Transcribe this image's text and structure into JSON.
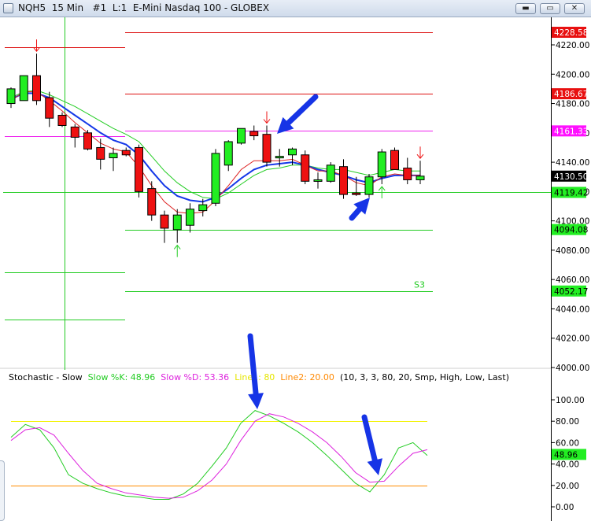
{
  "window": {
    "title": "NQH5  15 Min   #1  L:1  E-Mini Nasdaq 100 - GLOBEX",
    "buttons": [
      {
        "name": "minimize",
        "glyph": "▬"
      },
      {
        "name": "maximize",
        "glyph": "▭"
      },
      {
        "name": "close",
        "glyph": "✕"
      }
    ]
  },
  "chart_data": [
    {
      "type": "candlestick",
      "title": "",
      "symbol": "NQH5",
      "interval": "15 Min",
      "description": "E-Mini Nasdaq 100 - GLOBEX",
      "ylim": [
        4000,
        4240
      ],
      "y_ticks": [
        "4220.00",
        "4200.00",
        "4180.00",
        "4160.00",
        "4140.00",
        "4120.00",
        "4100.00",
        "4080.00",
        "4060.00",
        "4040.00",
        "4020.00",
        "4000.00"
      ],
      "price_markers": [
        {
          "label": "4228.58",
          "value": 4228.58,
          "color": "#e81010",
          "text_color": "#ffffff"
        },
        {
          "label": "4186.67",
          "value": 4186.67,
          "color": "#e81010",
          "text_color": "#ffffff"
        },
        {
          "label": "4161.33",
          "value": 4161.33,
          "color": "#ff10ff",
          "text_color": "#ffffff"
        },
        {
          "label": "4130.50",
          "value": 4130.5,
          "color": "#000000",
          "text_color": "#ffffff"
        },
        {
          "label": "4119.42",
          "value": 4119.42,
          "color": "#22ee22",
          "text_color": "#000000"
        },
        {
          "label": "4094.08",
          "value": 4094.08,
          "color": "#22ee22",
          "text_color": "#000000"
        },
        {
          "label": "4052.17",
          "value": 4052.17,
          "color": "#22ee22",
          "text_color": "#000000"
        }
      ],
      "level_lines": [
        {
          "value": 4228.58,
          "color": "#dd1111",
          "segment": "right"
        },
        {
          "value": 4218.5,
          "color": "#dd1111",
          "segment": "left"
        },
        {
          "value": 4186.67,
          "color": "#dd1111",
          "segment": "right"
        },
        {
          "value": 4161.33,
          "color": "#ee22ee",
          "segment": "right"
        },
        {
          "value": 4157.5,
          "color": "#ee22ee",
          "segment": "left"
        },
        {
          "value": 4119.42,
          "color": "#22cc22",
          "segment": "full"
        },
        {
          "value": 4094.08,
          "color": "#22cc22",
          "segment": "right"
        },
        {
          "value": 4065,
          "color": "#22cc22",
          "segment": "left"
        },
        {
          "value": 4052.17,
          "color": "#22cc22",
          "segment": "right",
          "label": "S3"
        },
        {
          "value": 4032.5,
          "color": "#22cc22",
          "segment": "left"
        }
      ],
      "candles": [
        {
          "o": 4180,
          "h": 4191,
          "l": 4177,
          "c": 4190
        },
        {
          "o": 4182,
          "h": 4199,
          "l": 4182,
          "c": 4199
        },
        {
          "o": 4199,
          "h": 4214,
          "l": 4179,
          "c": 4182
        },
        {
          "o": 4184,
          "h": 4188,
          "l": 4164,
          "c": 4170
        },
        {
          "o": 4172,
          "h": 4174,
          "l": 4164,
          "c": 4165
        },
        {
          "o": 4164,
          "h": 4166,
          "l": 4150,
          "c": 4157
        },
        {
          "o": 4160,
          "h": 4162,
          "l": 4148,
          "c": 4149
        },
        {
          "o": 4150,
          "h": 4156,
          "l": 4135,
          "c": 4142
        },
        {
          "o": 4143,
          "h": 4150,
          "l": 4134,
          "c": 4146
        },
        {
          "o": 4148,
          "h": 4150,
          "l": 4144,
          "c": 4145
        },
        {
          "o": 4150,
          "h": 4152,
          "l": 4116,
          "c": 4120
        },
        {
          "o": 4122,
          "h": 4127,
          "l": 4100,
          "c": 4104
        },
        {
          "o": 4104,
          "h": 4107,
          "l": 4085,
          "c": 4095
        },
        {
          "o": 4094,
          "h": 4108,
          "l": 4085,
          "c": 4104
        },
        {
          "o": 4097,
          "h": 4112,
          "l": 4092,
          "c": 4108
        },
        {
          "o": 4107,
          "h": 4115,
          "l": 4103,
          "c": 4111
        },
        {
          "o": 4112,
          "h": 4149,
          "l": 4110,
          "c": 4146
        },
        {
          "o": 4138,
          "h": 4155,
          "l": 4134,
          "c": 4154
        },
        {
          "o": 4153,
          "h": 4163,
          "l": 4152,
          "c": 4163
        },
        {
          "o": 4161,
          "h": 4165,
          "l": 4155,
          "c": 4158
        },
        {
          "o": 4159,
          "h": 4165,
          "l": 4137,
          "c": 4140
        },
        {
          "o": 4143,
          "h": 4149,
          "l": 4137,
          "c": 4144
        },
        {
          "o": 4145,
          "h": 4150,
          "l": 4138,
          "c": 4149
        },
        {
          "o": 4145,
          "h": 4148,
          "l": 4125,
          "c": 4127
        },
        {
          "o": 4128,
          "h": 4133,
          "l": 4122,
          "c": 4128
        },
        {
          "o": 4127,
          "h": 4140,
          "l": 4126,
          "c": 4138
        },
        {
          "o": 4137,
          "h": 4142,
          "l": 4115,
          "c": 4118
        },
        {
          "o": 4119,
          "h": 4130,
          "l": 4117,
          "c": 4118
        },
        {
          "o": 4118,
          "h": 4132,
          "l": 4116,
          "c": 4130
        },
        {
          "o": 4130,
          "h": 4149,
          "l": 4125,
          "c": 4147
        },
        {
          "o": 4148,
          "h": 4150,
          "l": 4135,
          "c": 4135
        },
        {
          "o": 4136,
          "h": 4143,
          "l": 4125,
          "c": 4128
        },
        {
          "o": 4128,
          "h": 4141,
          "l": 4125,
          "c": 4130.5
        }
      ],
      "series": [
        {
          "style": "ema-thin",
          "color": "#22cc22",
          "values": [
            4184,
            4188,
            4189,
            4186,
            4182,
            4178,
            4173,
            4168,
            4163,
            4159,
            4154,
            4144,
            4134,
            4126,
            4120,
            4116,
            4115,
            4119,
            4125,
            4131,
            4135,
            4136,
            4138,
            4138,
            4136,
            4135,
            4135,
            4133,
            4131,
            4133,
            4135,
            4134,
            4134
          ]
        },
        {
          "style": "ema-blue",
          "color": "#1538e8",
          "values": [
            4183,
            4187,
            4187,
            4184,
            4178,
            4172,
            4166,
            4160,
            4155,
            4152,
            4145,
            4134,
            4124,
            4117,
            4114,
            4113,
            4116,
            4122,
            4129,
            4135,
            4138,
            4139,
            4140,
            4138,
            4135,
            4133,
            4131,
            4128,
            4126,
            4129,
            4131,
            4131,
            4131
          ]
        },
        {
          "style": "ema-fast",
          "color": "#dd2222",
          "values": [
            4182,
            4188,
            4188,
            4182,
            4175,
            4167,
            4160,
            4153,
            4149,
            4147,
            4137,
            4124,
            4113,
            4106,
            4105,
            4106,
            4114,
            4124,
            4135,
            4141,
            4141,
            4141,
            4142,
            4138,
            4134,
            4134,
            4131,
            4126,
            4124,
            4130,
            4132,
            4131,
            4131
          ]
        }
      ],
      "signal_arrows": [
        {
          "index": 2,
          "kind": "sell"
        },
        {
          "index": 13,
          "kind": "buy"
        },
        {
          "index": 20,
          "kind": "sell"
        },
        {
          "index": 29,
          "kind": "buy"
        },
        {
          "index": 32,
          "kind": "sell"
        }
      ]
    },
    {
      "type": "line",
      "title": "Stochastic - Slow",
      "ylim": [
        -8,
        110
      ],
      "y_ticks": [
        "100.00",
        "80.00",
        "60.00",
        "40.00",
        "20.00",
        "0.00"
      ],
      "legend": [
        {
          "text": "Stochastic - Slow",
          "color": "#000000"
        },
        {
          "text": "Slow %K: 48.96",
          "color": "#22cc22"
        },
        {
          "text": "Slow %D: 53.36",
          "color": "#dd22dd"
        },
        {
          "text": "Line1: 80",
          "color": "#e6e600"
        },
        {
          "text": "Line2: 20.00",
          "color": "#ff8800"
        },
        {
          "text": "(10, 3, 3, 80, 20, Smp, High, Low, Last)",
          "color": "#000000"
        }
      ],
      "reference_lines": [
        {
          "value": 80,
          "color": "#f2f200"
        },
        {
          "value": 20,
          "color": "#ff8c00"
        }
      ],
      "price_markers": [
        {
          "label": "48.96",
          "value": 48.96,
          "color": "#22ee22",
          "text_color": "#000000"
        }
      ],
      "series": [
        {
          "name": "Slow %K",
          "color": "#22cc22",
          "values": [
            65,
            77,
            72,
            55,
            30,
            22,
            17,
            13,
            10,
            9,
            7,
            7,
            12,
            22,
            38,
            55,
            78,
            90,
            85,
            78,
            70,
            60,
            48,
            35,
            22,
            14,
            30,
            55,
            60,
            48
          ]
        },
        {
          "name": "Slow %D",
          "color": "#dd22dd",
          "values": [
            62,
            72,
            74,
            67,
            50,
            34,
            22,
            17,
            13,
            11,
            9,
            8,
            9,
            15,
            25,
            40,
            62,
            80,
            87,
            84,
            78,
            70,
            60,
            47,
            32,
            23,
            24,
            38,
            50,
            53.36
          ]
        }
      ]
    }
  ],
  "annotations": {
    "arrow_color": "#1634e6",
    "arrows": [
      {
        "name": "arrow-price-top"
      },
      {
        "name": "arrow-price-bottom"
      },
      {
        "name": "arrow-stoch-top"
      },
      {
        "name": "arrow-stoch-bottom"
      }
    ]
  }
}
